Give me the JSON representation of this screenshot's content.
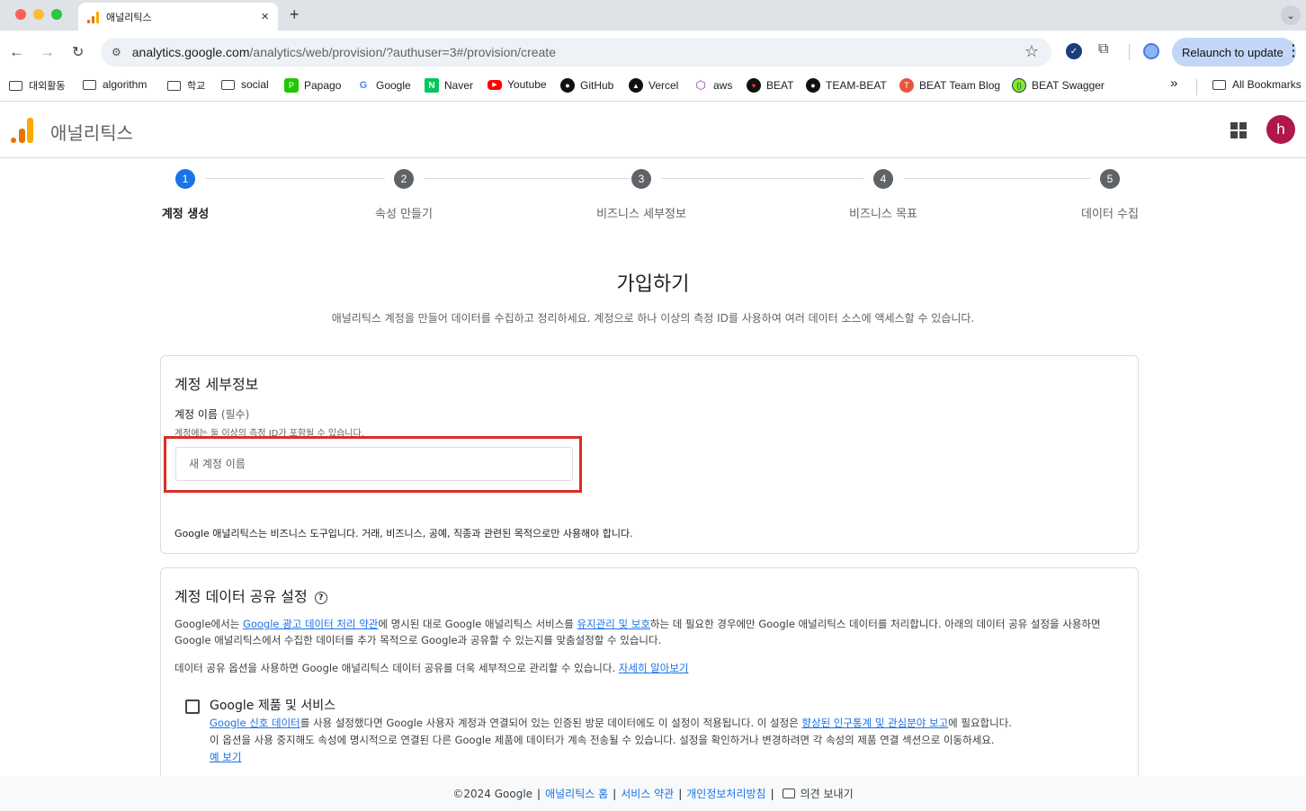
{
  "browser": {
    "tab_title": "애널리틱스",
    "tab_close": "×",
    "new_tab": "+",
    "url_host": "analytics.google.com",
    "url_path": "/analytics/web/provision/?authuser=3#/provision/create",
    "relaunch_label": "Relaunch to update",
    "bookmarks": [
      {
        "label": "대외활동",
        "icon": "folder-icon"
      },
      {
        "label": "algorithm",
        "icon": "folder-icon"
      },
      {
        "label": "학교",
        "icon": "folder-icon"
      },
      {
        "label": "social",
        "icon": "folder-icon"
      },
      {
        "label": "Papago",
        "icon": "papago-icon"
      },
      {
        "label": "Google",
        "icon": "google-icon"
      },
      {
        "label": "Naver",
        "icon": "naver-icon"
      },
      {
        "label": "Youtube",
        "icon": "youtube-icon"
      },
      {
        "label": "GitHub",
        "icon": "github-icon"
      },
      {
        "label": "Vercel",
        "icon": "vercel-icon"
      },
      {
        "label": "aws",
        "icon": "aws-icon"
      },
      {
        "label": "BEAT",
        "icon": "beat-icon"
      },
      {
        "label": "TEAM-BEAT",
        "icon": "github-icon"
      },
      {
        "label": "BEAT Team Blog",
        "icon": "blog-icon"
      },
      {
        "label": "BEAT Swagger",
        "icon": "swagger-icon"
      }
    ],
    "more_bookmarks": "»",
    "all_bookmarks": "All Bookmarks"
  },
  "app": {
    "title": "애널리틱스",
    "avatar_letter": "h"
  },
  "stepper": [
    {
      "number": "1",
      "label": "계정 생성",
      "active": true
    },
    {
      "number": "2",
      "label": "속성 만들기",
      "active": false
    },
    {
      "number": "3",
      "label": "비즈니스 세부정보",
      "active": false
    },
    {
      "number": "4",
      "label": "비즈니스 목표",
      "active": false
    },
    {
      "number": "5",
      "label": "데이터 수집",
      "active": false
    }
  ],
  "main": {
    "title": "가입하기",
    "subtitle": "애널리틱스 계정을 만들어 데이터를 수집하고 정리하세요. 계정으로 하나 이상의 측정 ID를 사용하여 여러 데이터 소스에 액세스할 수 있습니다."
  },
  "account_details": {
    "section_title": "계정 세부정보",
    "field_label": "계정 이름",
    "field_required": "(필수)",
    "field_hint": "계정에는 둘 이상의 측정 ID가 포함될 수 있습니다.",
    "field_value": "",
    "field_placeholder": "새 계정 이름",
    "business_note": "Google 애널리틱스는 비즈니스 도구입니다. 거래, 비즈니스, 공예, 직종과 관련된 목적으로만 사용해야 합니다."
  },
  "data_sharing": {
    "section_title": "계정 데이터 공유 설정",
    "help_glyph": "?",
    "para1_a": "Google에서는 ",
    "para1_link1": "Google 광고 데이터 처리 약관",
    "para1_b": "에 명시된 대로 Google 애널리틱스 서비스를 ",
    "para1_link2": "유지관리 및 보호",
    "para1_c": "하는 데 필요한 경우에만 Google 애널리틱스 데이터를 처리합니다. 아래의 데이터 공유 설정을 사용하면 Google 애널리틱스에서 수집한 데이터를 추가 목적으로 Google과 공유할 수 있는지를 맞춤설정할 수 있습니다.",
    "para2_a": "데이터 공유 옵션을 사용하면 Google 애널리틱스 데이터 공유를 더욱 세부적으로 관리할 수 있습니다. ",
    "para2_link": "자세히 알아보기",
    "option_title": "Google 제품 및 서비스",
    "option_checked": false,
    "option_link1": "Google 신호 데이터",
    "option_a": "를 사용 설정했다면 Google 사용자 계정과 연결되어 있는 인증된 방문 데이터에도 이 설정이 적용됩니다. 이 설정은 ",
    "option_link2": "향상된 인구통계 및 관심분야 보고",
    "option_b": "에 필요합니다.",
    "option_line2": "이 옵션을 사용 중지해도 속성에 명시적으로 연결된 다른 Google 제품에 데이터가 계속 전송될 수 있습니다. 설정을 확인하거나 변경하려면 각 속성의 제품 연결 섹션으로 이동하세요.",
    "option_example": "예 보기"
  },
  "footer": {
    "copyright": "©2024 Google",
    "sep": "|",
    "home": "애널리틱스 홈",
    "terms": "서비스 약관",
    "privacy": "개인정보처리방침",
    "feedback": "의견 보내기"
  },
  "colors": {
    "accent": "#1a73e8",
    "highlight": "#d93025",
    "avatar": "#b0184a",
    "logo_orange": "#e37400",
    "logo_yellow": "#f9ab00"
  }
}
